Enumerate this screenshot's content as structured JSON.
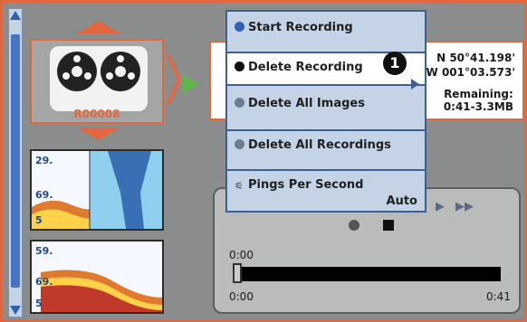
{
  "recording": {
    "id": "R00008"
  },
  "position": {
    "lat": "N 50°41.198'",
    "lon": "W 001°03.573'"
  },
  "remaining": {
    "label": "Remaining:",
    "value": "0:41-3.3MB"
  },
  "menu": {
    "items": [
      {
        "label": "Start Recording"
      },
      {
        "label": "Delete Recording"
      },
      {
        "label": "Delete All Images"
      },
      {
        "label": "Delete All Recordings"
      },
      {
        "label": "Pings Per Second",
        "value": "Auto"
      }
    ]
  },
  "callout": {
    "number": "1"
  },
  "playback": {
    "time_top": "0:00",
    "time_start": "0:00",
    "time_end": "0:41",
    "fast_forward": "▶▶",
    "progress": 0.0
  },
  "thumbnails": [
    {
      "depth_top": "29.",
      "depth_mid": "69.",
      "depth_bot": "5"
    },
    {
      "depth_top": "59.",
      "depth_mid": "69.",
      "depth_bot": "5"
    }
  ],
  "colors": {
    "accent": "#e2673f",
    "menu_bg": "#c4d4e6",
    "menu_border": "#3f5f8f",
    "play": "#5fb548"
  }
}
